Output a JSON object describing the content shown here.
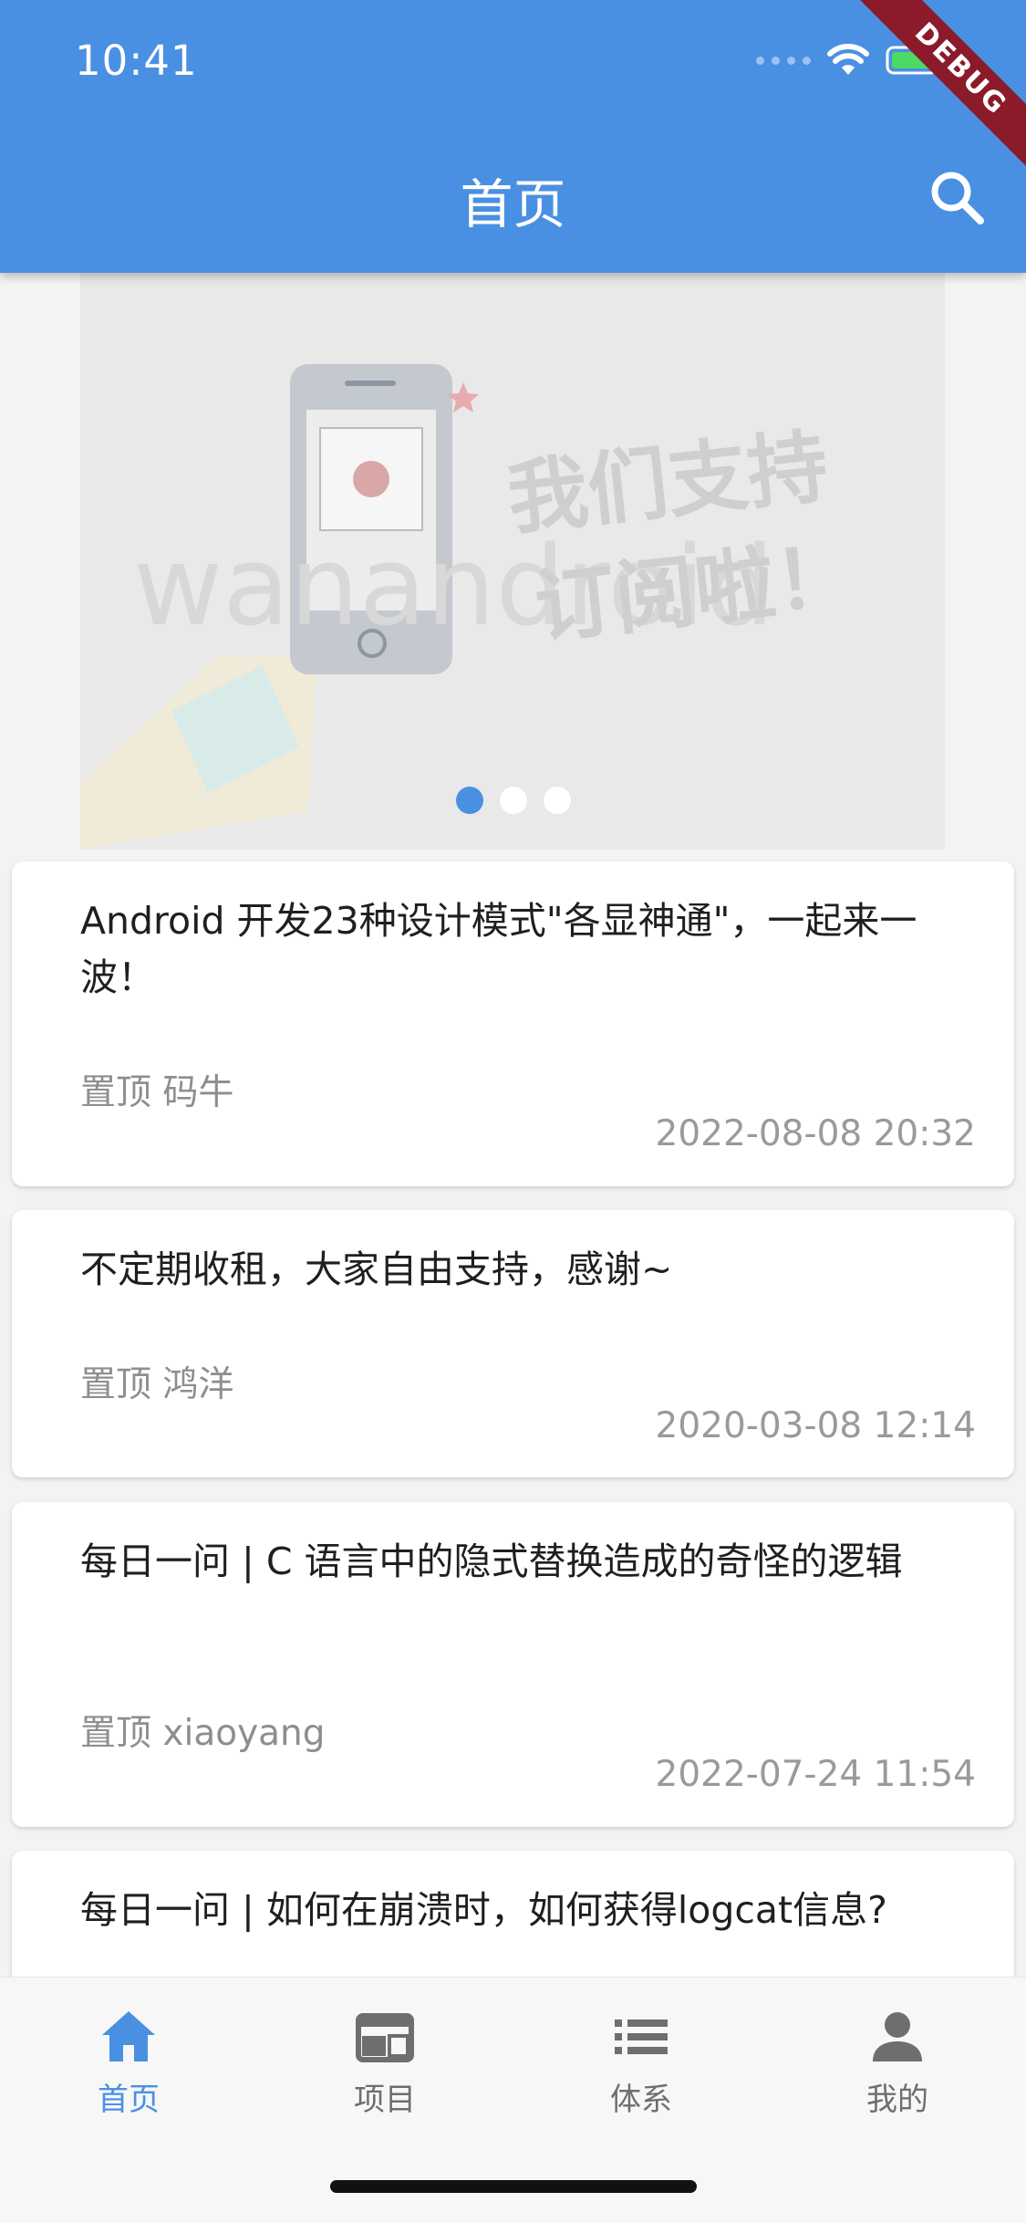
{
  "status_bar": {
    "time": "10:41"
  },
  "app_bar": {
    "title": "首页"
  },
  "debug_ribbon": "DEBUG",
  "banner": {
    "watermark": "wanandroid",
    "line1": "我们支持",
    "line2": "订阅啦！",
    "page_count": 3,
    "active_index": 0
  },
  "articles": [
    {
      "title": "Android 开发23种设计模式\"各显神通\"，一起来一波！",
      "meta": "置顶 码牛",
      "date": "2022-08-08 20:32"
    },
    {
      "title": "不定期收租，大家自由支持，感谢~",
      "meta": "置顶 鸿洋",
      "date": "2020-03-08 12:14"
    },
    {
      "title": "每日一问 | C 语言中的隐式替换造成的奇怪的逻辑",
      "meta": "置顶 xiaoyang",
      "date": "2022-07-24 11:54"
    },
    {
      "title": "每日一问 | 如何在崩溃时，如何获得logcat信息?",
      "meta": "",
      "date": ""
    }
  ],
  "bottom_nav": [
    {
      "label": "首页",
      "icon": "home-icon",
      "active": true
    },
    {
      "label": "项目",
      "icon": "project-icon",
      "active": false
    },
    {
      "label": "体系",
      "icon": "list-icon",
      "active": false
    },
    {
      "label": "我的",
      "icon": "person-icon",
      "active": false
    }
  ],
  "colors": {
    "primary": "#4a90e2",
    "inactive": "#6e6e6e",
    "meta_text": "#8e8e8e"
  }
}
